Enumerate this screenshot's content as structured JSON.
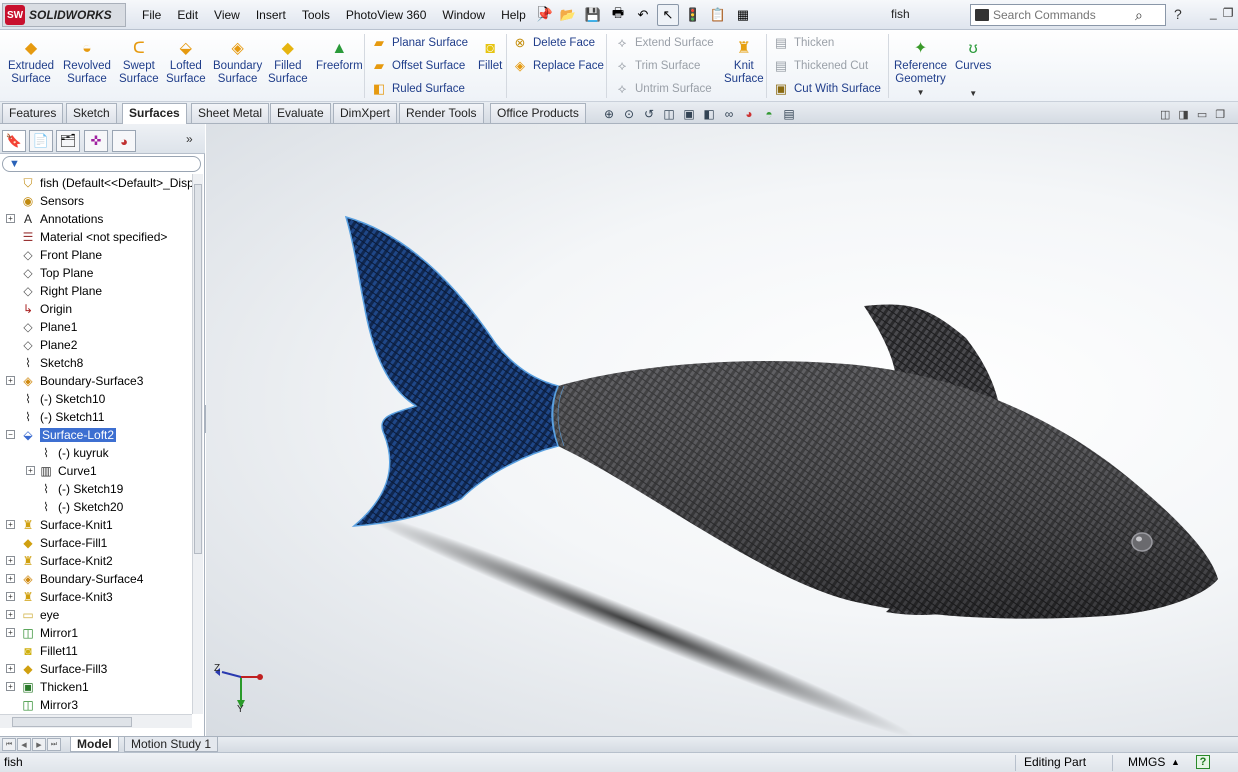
{
  "app": {
    "logo_text": "SOLIDWORKS",
    "logo_mark": "SW",
    "document_title": "fish"
  },
  "menu": [
    "File",
    "Edit",
    "View",
    "Insert",
    "Tools",
    "PhotoView 360",
    "Window",
    "Help"
  ],
  "search": {
    "placeholder": "Search Commands"
  },
  "command_manager": {
    "big": [
      {
        "label1": "Extruded",
        "label2": "Surface",
        "icon": "extruded-surface-icon"
      },
      {
        "label1": "Revolved",
        "label2": "Surface",
        "icon": "revolved-surface-icon"
      },
      {
        "label1": "Swept",
        "label2": "Surface",
        "icon": "swept-surface-icon"
      },
      {
        "label1": "Lofted",
        "label2": "Surface",
        "icon": "lofted-surface-icon"
      },
      {
        "label1": "Boundary",
        "label2": "Surface",
        "icon": "boundary-surface-icon"
      },
      {
        "label1": "Filled",
        "label2": "Surface",
        "icon": "filled-surface-icon"
      },
      {
        "label1": "Freeform",
        "label2": "",
        "icon": "freeform-icon"
      }
    ],
    "col1": [
      "Planar Surface",
      "Offset Surface",
      "Ruled Surface"
    ],
    "fillet": "Fillet",
    "col2": [
      "Delete Face",
      "Replace Face"
    ],
    "col3": [
      "Extend Surface",
      "Trim Surface",
      "Untrim Surface"
    ],
    "knit": {
      "label1": "Knit",
      "label2": "Surface"
    },
    "col4": [
      "Thicken",
      "Thickened Cut",
      "Cut With Surface"
    ],
    "ref": {
      "label1": "Reference",
      "label2": "Geometry"
    },
    "curves": "Curves"
  },
  "tabs": [
    "Features",
    "Sketch",
    "Surfaces",
    "Sheet Metal",
    "Evaluate",
    "DimXpert",
    "Render Tools",
    "Office Products"
  ],
  "active_tab": "Surfaces",
  "tree": {
    "root": "fish  (Default<<Default>_Displa",
    "items": [
      {
        "label": "Sensors",
        "icon": "sensors-icon"
      },
      {
        "label": "Annotations",
        "icon": "annotations-icon"
      },
      {
        "label": "Material <not specified>",
        "icon": "material-icon"
      },
      {
        "label": "Front Plane",
        "icon": "plane-icon"
      },
      {
        "label": "Top Plane",
        "icon": "plane-icon"
      },
      {
        "label": "Right Plane",
        "icon": "plane-icon"
      },
      {
        "label": "Origin",
        "icon": "origin-icon"
      },
      {
        "label": "Plane1",
        "icon": "plane-icon"
      },
      {
        "label": "Plane2",
        "icon": "plane-icon"
      },
      {
        "label": "Sketch8",
        "icon": "sketch-icon"
      },
      {
        "label": "Boundary-Surface3",
        "icon": "boundary-surface-icon"
      },
      {
        "label": "(-) Sketch10",
        "icon": "sketch-icon"
      },
      {
        "label": "(-) Sketch11",
        "icon": "sketch-icon"
      },
      {
        "label": "Surface-Loft2",
        "icon": "loft-icon"
      },
      {
        "label": "(-) kuyruk",
        "icon": "sketch-icon"
      },
      {
        "label": "Curve1",
        "icon": "curve-icon"
      },
      {
        "label": "(-) Sketch19",
        "icon": "sketch-icon"
      },
      {
        "label": "(-) Sketch20",
        "icon": "sketch-icon"
      },
      {
        "label": "Surface-Knit1",
        "icon": "knit-icon"
      },
      {
        "label": "Surface-Fill1",
        "icon": "fill-icon"
      },
      {
        "label": "Surface-Knit2",
        "icon": "knit-icon"
      },
      {
        "label": "Boundary-Surface4",
        "icon": "boundary-surface-icon"
      },
      {
        "label": "Surface-Knit3",
        "icon": "knit-icon"
      },
      {
        "label": "eye",
        "icon": "folder-icon"
      },
      {
        "label": "Mirror1",
        "icon": "mirror-icon"
      },
      {
        "label": "Fillet11",
        "icon": "fillet-icon"
      },
      {
        "label": "Surface-Fill3",
        "icon": "fill-icon"
      },
      {
        "label": "Thicken1",
        "icon": "thicken-icon"
      },
      {
        "label": "Mirror3",
        "icon": "mirror-icon"
      }
    ]
  },
  "triad": {
    "z": "Z",
    "y": "Y"
  },
  "bottom_tabs": [
    "Model",
    "Motion Study 1"
  ],
  "status": {
    "doc": "fish",
    "mode": "Editing Part",
    "units": "MMGS",
    "help": "?"
  },
  "colors": {
    "accent": "#1f3d8a",
    "selection": "#3d6fd1",
    "tail": "#1a3f7a",
    "body": "#3a3a3c"
  }
}
